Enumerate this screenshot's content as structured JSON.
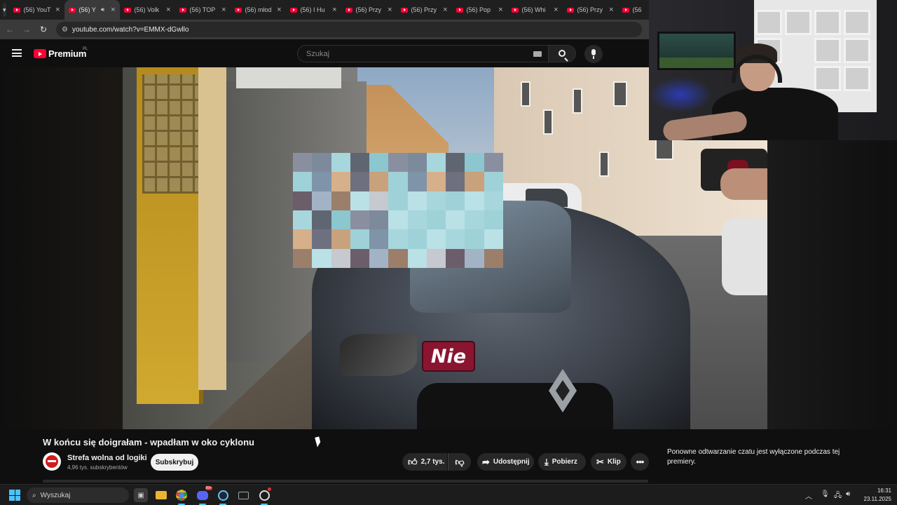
{
  "browser": {
    "tabs": [
      {
        "title": "(56) YouT",
        "active": false
      },
      {
        "title": "(56) Y",
        "active": true,
        "audio": true
      },
      {
        "title": "(56) Volk",
        "active": false
      },
      {
        "title": "(56) TOP",
        "active": false
      },
      {
        "title": "(56) młod",
        "active": false
      },
      {
        "title": "(56) I Hu",
        "active": false
      },
      {
        "title": "(56) Przy",
        "active": false
      },
      {
        "title": "(56) Przy",
        "active": false
      },
      {
        "title": "(56) Pop",
        "active": false
      },
      {
        "title": "(56) Whi",
        "active": false
      },
      {
        "title": "(56) Przy",
        "active": false
      },
      {
        "title": "(56",
        "active": false
      }
    ],
    "url": "youtube.com/watch?v=EMMX-dGwllo"
  },
  "youtube": {
    "logo_text": "Premium",
    "region": "PL",
    "search_placeholder": "Szukaj"
  },
  "video": {
    "subtitle": "Nie",
    "title": "W końcu się doigrałam - wpadłam w oko cyklonu"
  },
  "channel": {
    "name": "Strefa wolna od logiki",
    "subscribers": "4,96 tys. subskrybentów",
    "subscribe_label": "Subskrybuj"
  },
  "actions": {
    "likes": "2,7 tys.",
    "share": "Udostępnij",
    "download": "Pobierz",
    "clip": "Klip"
  },
  "chat": {
    "note": "Ponowne odtwarzanie czatu jest wyłączone podczas tej premiery."
  },
  "taskbar": {
    "search_label": "Wyszukaj",
    "time": "16:31",
    "date": "23.11.2025",
    "discord_badge": "99+"
  },
  "colors": {
    "youtube_red": "#ff0033",
    "windows_accent": "#4cc2ff",
    "subtitle_bg": "#8a1530"
  }
}
